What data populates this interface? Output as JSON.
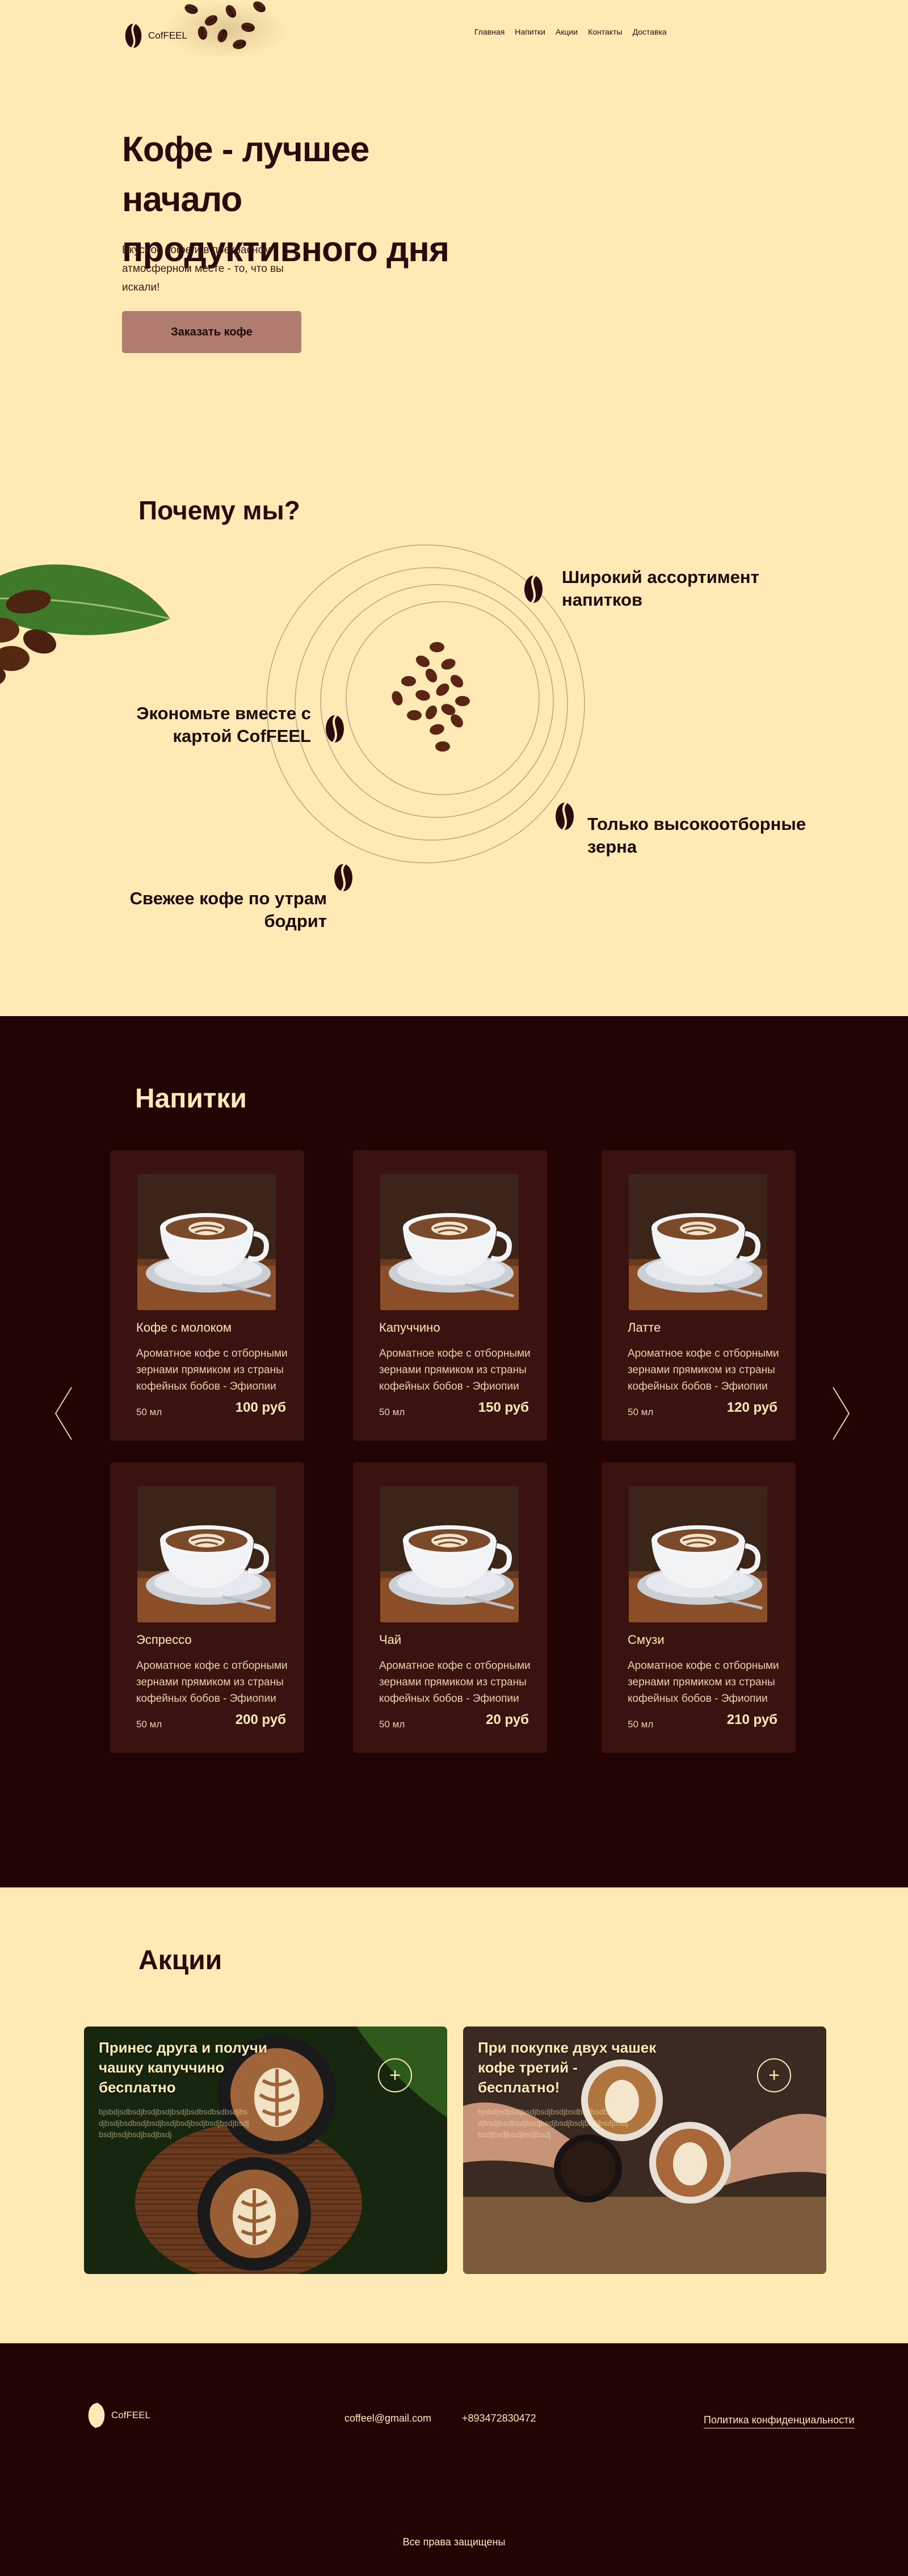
{
  "header": {
    "logo_text": "CofFEEL",
    "nav": [
      {
        "label": "Главная"
      },
      {
        "label": "Напитки"
      },
      {
        "label": "Акции"
      },
      {
        "label": "Контакты"
      },
      {
        "label": "Доставка"
      }
    ]
  },
  "hero": {
    "title": "Кофе - лучшее начало продуктивного дня",
    "subtitle": "Вкусное кофе и в прекрасном атмосферном месте - то, что вы искали!",
    "cta_label": "Заказать кофе"
  },
  "why": {
    "title": "Почему мы?",
    "features": [
      {
        "label": "Широкий ассортимент напитков"
      },
      {
        "label": "Экономьте вместе с картой CofFEEL"
      },
      {
        "label": "Только высокоотборные зерна"
      },
      {
        "label": "Свежее кофе по утрам бодрит"
      }
    ]
  },
  "drinks": {
    "title": "Напитки",
    "items": [
      {
        "name": "Кофе с молоком",
        "description": "Ароматное кофе с отборными зернами прямиком из страны кофейных бобов - Эфиопии",
        "volume": "50 мл",
        "price": "100 руб"
      },
      {
        "name": "Капуччино",
        "description": "Ароматное кофе с отборными зернами прямиком из страны кофейных бобов - Эфиопии",
        "volume": "50 мл",
        "price": "150 руб"
      },
      {
        "name": "Латте",
        "description": "Ароматное кофе с отборными зернами прямиком из страны кофейных бобов - Эфиопии",
        "volume": "50 мл",
        "price": "120 руб"
      },
      {
        "name": "Эспрессо",
        "description": "Ароматное кофе с отборными зернами прямиком из страны кофейных бобов - Эфиопии",
        "volume": "50 мл",
        "price": "200 руб"
      },
      {
        "name": "Чай",
        "description": "Ароматное кофе с отборными зернами прямиком из страны кофейных бобов - Эфиопии",
        "volume": "50 мл",
        "price": "20 руб"
      },
      {
        "name": "Смузи",
        "description": "Ароматное кофе с отборными зернами прямиком из страны кофейных бобов - Эфиопии",
        "volume": "50 мл",
        "price": "210 руб"
      }
    ]
  },
  "promos": {
    "title": "Акции",
    "items": [
      {
        "title": "Принес друга и получи чашку капуччино бесплатно",
        "text": "bjsbdjsdbsdjbsdjbsdjbsdjbsdbsdbsdbsdjbsdjbsdjbsdbsdjbsdjbsdjbsdjbsdjbsdjbsdjbsdjbsdjbsdjbsdjbsdjbsdj",
        "plus": "+"
      },
      {
        "title": "При покупке двух чашек кофе третий - бесплатно!",
        "text": "bjsbdjsdbsdjbsdjbsdjbsdjbsdbsdbsdbsdjbsdjbsdjbsdbsdjbsdjbsdjbsdjbsdjbsdjbsdjbsdjbsdjbsdjbsdjbsdjbsdj",
        "plus": "+"
      }
    ]
  },
  "footer": {
    "logo_text": "CofFEEL",
    "email": "coffeel@gmail.com",
    "phone": "+893472830472",
    "policy": "Политика конфиденциальности",
    "rights": "Все права защищены"
  },
  "colors": {
    "background": "#FFEAB6",
    "dark": "#220404",
    "card": "#3A1210",
    "button": "#B07C70",
    "text": "#2A0A0A"
  },
  "icons": [
    "coffee-bean-logo-icon",
    "arrow-left-icon",
    "arrow-right-icon",
    "plus-icon"
  ]
}
